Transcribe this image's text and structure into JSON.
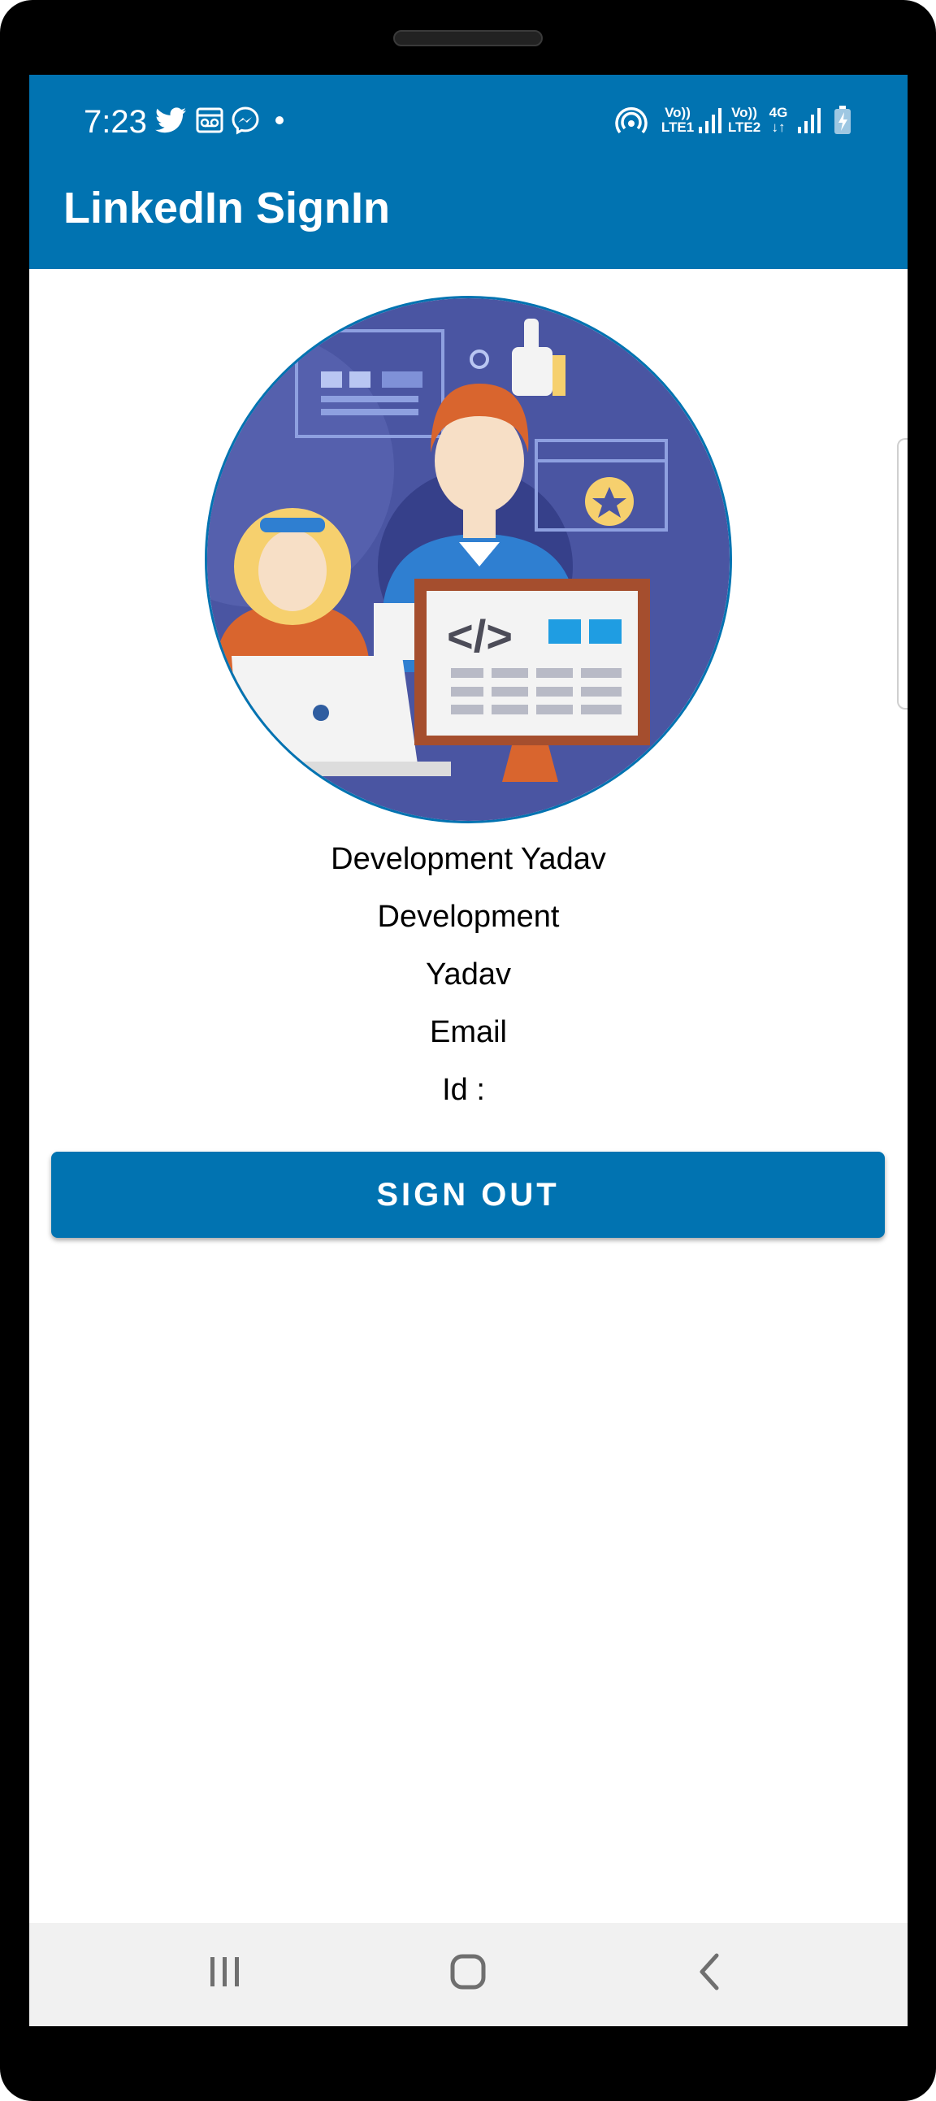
{
  "status_bar": {
    "time": "7:23",
    "notification_icons": [
      "twitter-icon",
      "voicemail-icon",
      "messenger-icon",
      "dot-icon"
    ],
    "network_labels": [
      "Vo))",
      "LTE1",
      "Vo))",
      "LTE2",
      "4G"
    ]
  },
  "app_bar": {
    "title": "LinkedIn SignIn"
  },
  "profile": {
    "full_name": "Development Yadav",
    "first_name": "Development",
    "last_name": "Yadav",
    "email_label": "Email",
    "id_label": "Id :"
  },
  "actions": {
    "sign_out_label": "SIGN OUT"
  },
  "colors": {
    "brand": "#0173b1",
    "nav_bar": "#f1f1f1"
  },
  "nav_bar": {
    "icons": [
      "recents-icon",
      "home-icon",
      "back-icon"
    ]
  }
}
